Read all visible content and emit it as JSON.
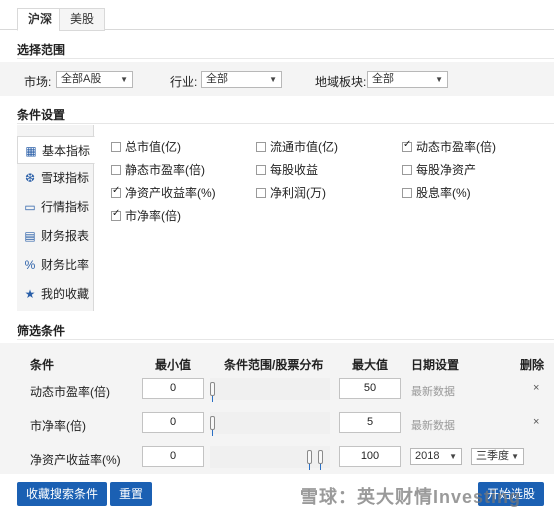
{
  "market_tabs": [
    "沪深",
    "美股"
  ],
  "scope": {
    "title": "选择范围",
    "market_label": "市场:",
    "market_value": "全部A股",
    "industry_label": "行业:",
    "industry_value": "全部",
    "region_label": "地域板块:",
    "region_value": "全部"
  },
  "conditions_title": "条件设置",
  "side_tabs": [
    {
      "label": "基本指标",
      "icon": "bar-grid-icon",
      "glyph": "▦"
    },
    {
      "label": "雪球指标",
      "icon": "snowball-icon",
      "glyph": "❆"
    },
    {
      "label": "行情指标",
      "icon": "monitor-chart-icon",
      "glyph": "▭"
    },
    {
      "label": "财务报表",
      "icon": "document-icon",
      "glyph": "▤"
    },
    {
      "label": "财务比率",
      "icon": "percent-icon",
      "glyph": "%"
    },
    {
      "label": "我的收藏",
      "icon": "star-icon",
      "glyph": "★"
    }
  ],
  "indicators": [
    {
      "label": "总市值(亿)",
      "checked": false
    },
    {
      "label": "流通市值(亿)",
      "checked": false
    },
    {
      "label": "动态市盈率(倍)",
      "checked": true
    },
    {
      "label": "静态市盈率(倍)",
      "checked": false
    },
    {
      "label": "每股收益",
      "checked": false
    },
    {
      "label": "每股净资产",
      "checked": false
    },
    {
      "label": "净资产收益率(%)",
      "checked": true
    },
    {
      "label": "净利润(万)",
      "checked": false
    },
    {
      "label": "股息率(%)",
      "checked": false
    },
    {
      "label": "市净率(倍)",
      "checked": true
    }
  ],
  "filter": {
    "title": "筛选条件",
    "headers": {
      "condition": "条件",
      "min": "最小值",
      "range": "条件范围/股票分布",
      "max": "最大值",
      "date": "日期设置",
      "delete": "删除"
    },
    "rows": [
      {
        "name": "动态市盈率(倍)",
        "min": "0",
        "max": "50",
        "date": "最新数据"
      },
      {
        "name": "市净率(倍)",
        "min": "0",
        "max": "5",
        "date": "最新数据"
      },
      {
        "name": "净资产收益率(%)",
        "min": "0",
        "max": "100",
        "year": "2018",
        "quarter": "三季度"
      }
    ],
    "delete_glyph": "×"
  },
  "buttons": {
    "save": "收藏搜索条件",
    "reset": "重置",
    "start": "开始选股"
  },
  "watermark": "雪球：英大财情Investing",
  "dropdown_arrow": "▼"
}
